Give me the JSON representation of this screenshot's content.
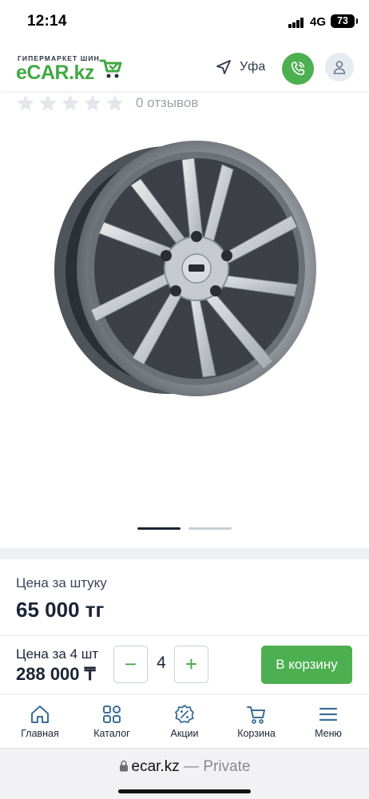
{
  "status_bar": {
    "time": "12:14",
    "network": "4G",
    "battery": "73"
  },
  "header": {
    "logo_tagline": "ГИПЕРМАРКЕТ ШИН",
    "logo_text": "eCAR.kz",
    "city": "Уфа",
    "accent_color": "#4caf50"
  },
  "rating": {
    "stars_filled": 0,
    "stars_total": 5,
    "reviews": "0 отзывов"
  },
  "carousel": {
    "active_index": 0,
    "count": 2
  },
  "price": {
    "label": "Цена за штуку",
    "value": "65 000 тг"
  },
  "cart": {
    "total_label": "Цена за 4 шт",
    "total_value": "288 000 ₸",
    "minus": "−",
    "plus": "+",
    "quantity": "4",
    "add_label": "В корзину"
  },
  "nav": {
    "items": [
      {
        "label": "Главная",
        "icon": "home-icon"
      },
      {
        "label": "Каталог",
        "icon": "catalog-icon"
      },
      {
        "label": "Акции",
        "icon": "percent-badge-icon"
      },
      {
        "label": "Корзина",
        "icon": "cart-icon"
      },
      {
        "label": "Меню",
        "icon": "menu-icon"
      }
    ]
  },
  "browser": {
    "domain": "ecar.kz",
    "separator": " — ",
    "mode": "Private"
  }
}
